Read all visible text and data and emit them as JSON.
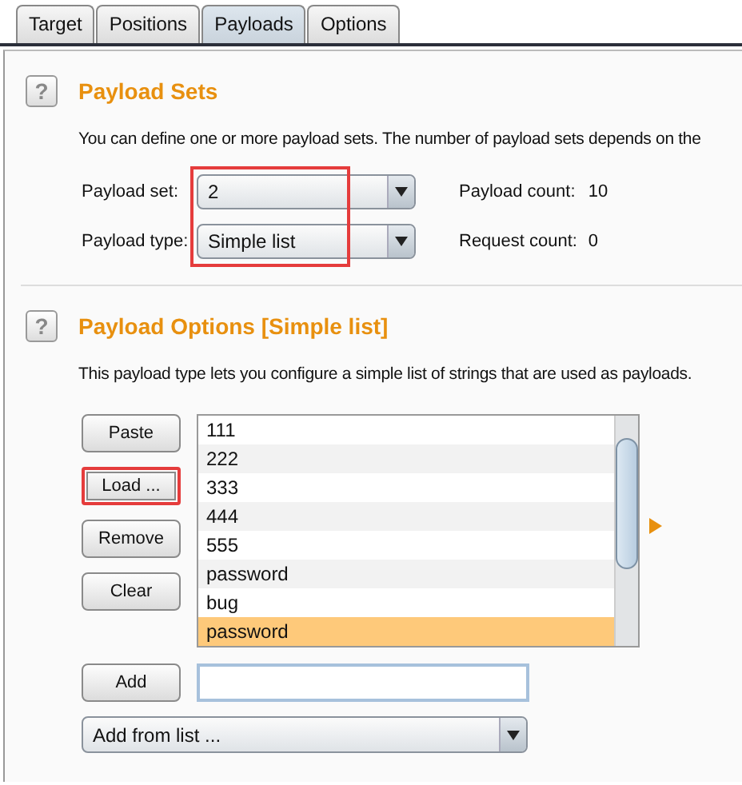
{
  "tabs": [
    {
      "label": "Target",
      "selected": false
    },
    {
      "label": "Positions",
      "selected": false
    },
    {
      "label": "Payloads",
      "selected": true
    },
    {
      "label": "Options",
      "selected": false
    }
  ],
  "payload_sets": {
    "help": "?",
    "title": "Payload Sets",
    "description": "You can define one or more payload sets. The number of payload sets depends on the",
    "fields": [
      {
        "label": "Payload set:",
        "value": "2",
        "info_label": "Payload count:",
        "info_value": "10"
      },
      {
        "label": "Payload type:",
        "value": "Simple list",
        "info_label": "Request count:",
        "info_value": "0"
      }
    ],
    "fields_highlighted": true
  },
  "payload_options": {
    "help": "?",
    "title": "Payload Options [Simple list]",
    "description": "This payload type lets you configure a simple list of strings that are used as payloads.",
    "buttons": [
      {
        "label": "Paste",
        "highlighted": false
      },
      {
        "label": "Load ...",
        "highlighted": true
      },
      {
        "label": "Remove",
        "highlighted": false
      },
      {
        "label": "Clear",
        "highlighted": false
      }
    ],
    "items": [
      {
        "text": "111",
        "selected": false
      },
      {
        "text": "222",
        "selected": false
      },
      {
        "text": "333",
        "selected": false
      },
      {
        "text": "444",
        "selected": false
      },
      {
        "text": "555",
        "selected": false
      },
      {
        "text": "password",
        "selected": false
      },
      {
        "text": "bug",
        "selected": false
      },
      {
        "text": "password",
        "selected": true
      }
    ],
    "add_button": "Add",
    "add_from_list": "Add from list ..."
  }
}
